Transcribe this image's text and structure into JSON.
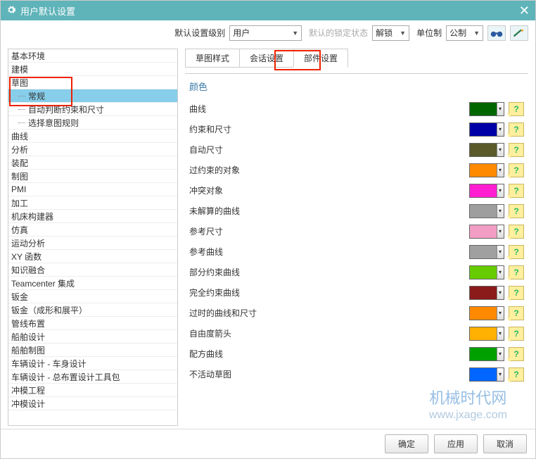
{
  "title": "用户默认设置",
  "toolbar": {
    "level_label": "默认设置级别",
    "level_value": "用户",
    "lock_label": "默认的锁定状态",
    "lock_value": "解锁",
    "unit_label": "单位制",
    "unit_value": "公制"
  },
  "sidebar": {
    "items": [
      {
        "label": "基本环境",
        "indent": 0
      },
      {
        "label": "建模",
        "indent": 0
      },
      {
        "label": "草图",
        "indent": 0
      },
      {
        "label": "常规",
        "indent": 1,
        "selected": true
      },
      {
        "label": "自动判断约束和尺寸",
        "indent": 1
      },
      {
        "label": "选择意图规则",
        "indent": 1
      },
      {
        "label": "曲线",
        "indent": 0
      },
      {
        "label": "分析",
        "indent": 0
      },
      {
        "label": "装配",
        "indent": 0
      },
      {
        "label": "制图",
        "indent": 0
      },
      {
        "label": "PMI",
        "indent": 0
      },
      {
        "label": "加工",
        "indent": 0
      },
      {
        "label": "机床构建器",
        "indent": 0
      },
      {
        "label": "仿真",
        "indent": 0
      },
      {
        "label": "运动分析",
        "indent": 0
      },
      {
        "label": "XY 函数",
        "indent": 0
      },
      {
        "label": "知识融合",
        "indent": 0
      },
      {
        "label": "Teamcenter 集成",
        "indent": 0
      },
      {
        "label": "钣金",
        "indent": 0
      },
      {
        "label": "钣金（成形和展平）",
        "indent": 0
      },
      {
        "label": "管线布置",
        "indent": 0
      },
      {
        "label": "船舶设计",
        "indent": 0
      },
      {
        "label": "船舶制图",
        "indent": 0
      },
      {
        "label": "车辆设计 - 车身设计",
        "indent": 0
      },
      {
        "label": "车辆设计 - 总布置设计工具包",
        "indent": 0
      },
      {
        "label": "冲模工程",
        "indent": 0
      },
      {
        "label": "冲模设计",
        "indent": 0
      }
    ]
  },
  "tabs": [
    {
      "label": "草图样式"
    },
    {
      "label": "会话设置"
    },
    {
      "label": "部件设置",
      "active": true
    }
  ],
  "section_title": "颜色",
  "colors": [
    {
      "label": "曲线",
      "color": "#006600"
    },
    {
      "label": "约束和尺寸",
      "color": "#0000a8"
    },
    {
      "label": "自动尺寸",
      "color": "#5a5a2a"
    },
    {
      "label": "过约束的对象",
      "color": "#ff8a00"
    },
    {
      "label": "冲突对象",
      "color": "#ff1fd0"
    },
    {
      "label": "未解算的曲线",
      "color": "#9e9e9e"
    },
    {
      "label": "参考尺寸",
      "color": "#f29ec4"
    },
    {
      "label": "参考曲线",
      "color": "#a0a0a0"
    },
    {
      "label": "部分约束曲线",
      "color": "#66cc00"
    },
    {
      "label": "完全约束曲线",
      "color": "#8b1a1a"
    },
    {
      "label": "过时的曲线和尺寸",
      "color": "#ff8a00"
    },
    {
      "label": "自由度箭头",
      "color": "#ffb000"
    },
    {
      "label": "配方曲线",
      "color": "#00a000"
    },
    {
      "label": "不活动草图",
      "color": "#0066ff"
    }
  ],
  "buttons": {
    "ok": "确定",
    "apply": "应用",
    "cancel": "取消"
  },
  "watermark": {
    "line1": "机械时代网",
    "line2": "www.jxage.com"
  }
}
